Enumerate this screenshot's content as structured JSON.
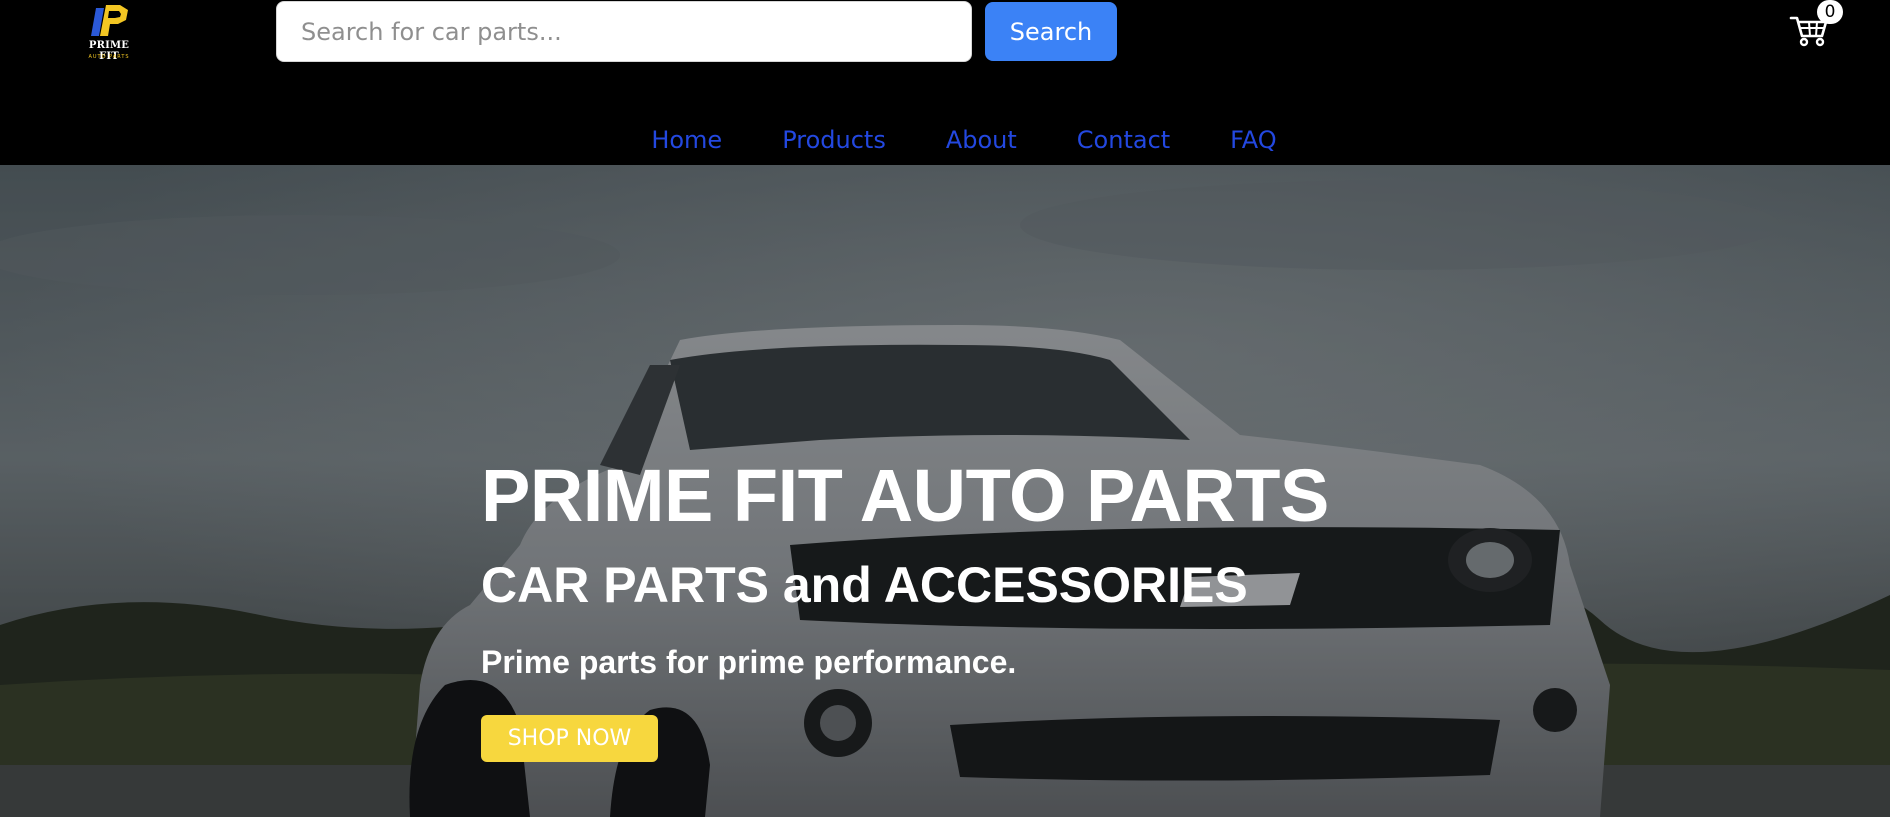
{
  "header": {
    "logo": {
      "name": "PRIME FIT",
      "sub": "AUTO PARTS"
    },
    "search": {
      "placeholder": "Search for car parts...",
      "value": "",
      "button_label": "Search"
    },
    "cart": {
      "count": "0",
      "icon": "cart-icon"
    }
  },
  "nav": {
    "items": [
      {
        "label": "Home"
      },
      {
        "label": "Products"
      },
      {
        "label": "About"
      },
      {
        "label": "Contact"
      },
      {
        "label": "FAQ"
      }
    ]
  },
  "hero": {
    "title": "PRIME FIT AUTO PARTS",
    "subtitle": "CAR PARTS and ACCESSORIES",
    "tagline": "Prime parts for prime performance.",
    "cta_label": "SHOP NOW"
  },
  "colors": {
    "header_bg": "#000000",
    "search_button": "#3b82f6",
    "nav_link": "#2348e0",
    "cta": "#f7d73e",
    "logo_accent": "#f3c623"
  }
}
